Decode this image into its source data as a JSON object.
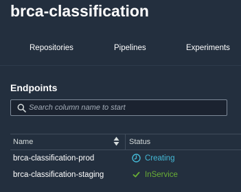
{
  "page": {
    "title": "brca-classification"
  },
  "tabs": [
    {
      "label": "Repositories"
    },
    {
      "label": "Pipelines"
    },
    {
      "label": "Experiments"
    }
  ],
  "endpoints": {
    "section_title": "Endpoints",
    "search": {
      "placeholder": "Search column name to start",
      "value": "",
      "icon": "search-icon"
    },
    "columns": {
      "name": "Name",
      "status": "Status"
    },
    "rows": [
      {
        "name": "brca-classification-prod",
        "status": "Creating",
        "status_icon": "clock-icon",
        "status_color": "#44b9d6"
      },
      {
        "name": "brca-classification-staging",
        "status": "InService",
        "status_icon": "check-icon",
        "status_color": "#6aaf35"
      }
    ]
  },
  "colors": {
    "background": "#232f3e",
    "input_border": "#7d8998",
    "creating": "#44b9d6",
    "in_service": "#6aaf35"
  }
}
